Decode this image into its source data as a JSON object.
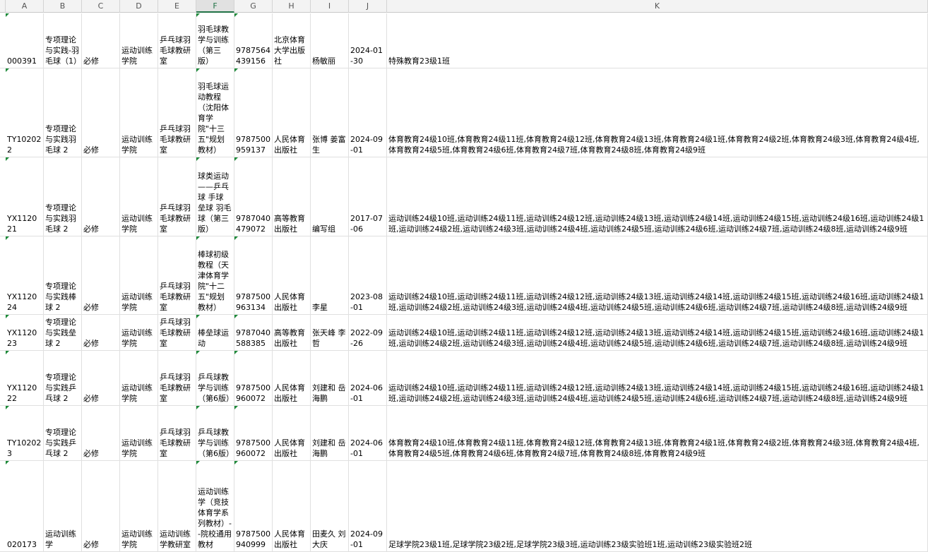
{
  "columns": [
    "A",
    "B",
    "C",
    "D",
    "E",
    "F",
    "G",
    "H",
    "I",
    "J",
    "K"
  ],
  "rows": [
    [
      "000391",
      "专项理论与实践-羽毛球（1）",
      "必修",
      "运动训练学院",
      "乒乓球羽毛球教研室",
      "羽毛球教学与训练（第三版）",
      "9787564439156",
      "北京体育大学出版社",
      "杨敏丽",
      "2024-01-30",
      "特殊教育23级1班"
    ],
    [
      "TY102022",
      "专项理论与实践羽毛球 2",
      "必修",
      "运动训练学院",
      "乒乓球羽毛球教研室",
      "羽毛球运动教程（沈阳体育学院\"十三五\"规划教材）",
      "9787500959137",
      "人民体育出版社",
      "张博 姜富生",
      "2024-09-01",
      "体育教育24级10班,体育教育24级11班,体育教育24级12班,体育教育24级13班,体育教育24级1班,体育教育24级2班,体育教育24级3班,体育教育24级4班,体育教育24级5班,体育教育24级6班,体育教育24级7班,体育教育24级8班,体育教育24级9班"
    ],
    [
      "YX112021",
      "专项理论与实践羽毛球 2",
      "必修",
      "运动训练学院",
      "乒乓球羽毛球教研室",
      "球类运动——乒乓球 手球 垒球 羽毛球（第三版）",
      "9787040479072",
      "高等教育出版社",
      "编写组",
      "2017-07-06",
      "运动训练24级10班,运动训练24级11班,运动训练24级12班,运动训练24级13班,运动训练24级14班,运动训练24级15班,运动训练24级16班,运动训练24级1班,运动训练24级2班,运动训练24级3班,运动训练24级4班,运动训练24级5班,运动训练24级6班,运动训练24级7班,运动训练24级8班,运动训练24级9班"
    ],
    [
      "YX112024",
      "专项理论与实践棒球 2",
      "必修",
      "运动训练学院",
      "乒乓球羽毛球教研室",
      "棒球初级教程（天津体育学院\"十二五\"规划教材）",
      "9787500963134",
      "人民体育出版社",
      "李星",
      "2023-08-01",
      "运动训练24级10班,运动训练24级11班,运动训练24级12班,运动训练24级13班,运动训练24级14班,运动训练24级15班,运动训练24级16班,运动训练24级1班,运动训练24级2班,运动训练24级3班,运动训练24级4班,运动训练24级5班,运动训练24级6班,运动训练24级7班,运动训练24级8班,运动训练24级9班"
    ],
    [
      "YX112023",
      "专项理论与实践垒球 2",
      "必修",
      "运动训练学院",
      "乒乓球羽毛球教研室",
      "棒垒球运动",
      "9787040588385",
      "高等教育出版社",
      "张天峰 李哲",
      "2022-09-26",
      "运动训练24级10班,运动训练24级11班,运动训练24级12班,运动训练24级13班,运动训练24级14班,运动训练24级15班,运动训练24级16班,运动训练24级1班,运动训练24级2班,运动训练24级3班,运动训练24级4班,运动训练24级5班,运动训练24级6班,运动训练24级7班,运动训练24级8班,运动训练24级9班"
    ],
    [
      "YX112022",
      "专项理论与实践乒乓球 2",
      "必修",
      "运动训练学院",
      "乒乓球羽毛球教研室",
      "乒乓球教学与训练（第6版）",
      "9787500960072",
      "人民体育出版社",
      "刘建和 岳海鹏",
      "2024-06-01",
      "运动训练24级10班,运动训练24级11班,运动训练24级12班,运动训练24级13班,运动训练24级14班,运动训练24级15班,运动训练24级16班,运动训练24级1班,运动训练24级2班,运动训练24级3班,运动训练24级4班,运动训练24级5班,运动训练24级6班,运动训练24级7班,运动训练24级8班,运动训练24级9班"
    ],
    [
      "TY102023",
      "专项理论与实践乒乓球 2",
      "必修",
      "运动训练学院",
      "乒乓球羽毛球教研室",
      "乒乓球教学与训练（第6版）",
      "9787500960072",
      "人民体育出版社",
      "刘建和 岳海鹏",
      "2024-06-01",
      "体育教育24级10班,体育教育24级11班,体育教育24级12班,体育教育24级13班,体育教育24级1班,体育教育24级2班,体育教育24级3班,体育教育24级4班,体育教育24级5班,体育教育24级6班,体育教育24级7班,体育教育24级8班,体育教育24级9班"
    ],
    [
      "020173",
      "运动训练学",
      "必修",
      "运动训练学院",
      "运动训练学教研室",
      "运动训练学（竞技体育学系列教材）--院校通用教材",
      "9787500940999",
      "人民体育出版社",
      "田麦久 刘大庆",
      "2024-09-01",
      "足球学院23级1班,足球学院23级2班,足球学院23级3班,运动训练23级实验班1班,运动训练23级实验班2班"
    ]
  ]
}
